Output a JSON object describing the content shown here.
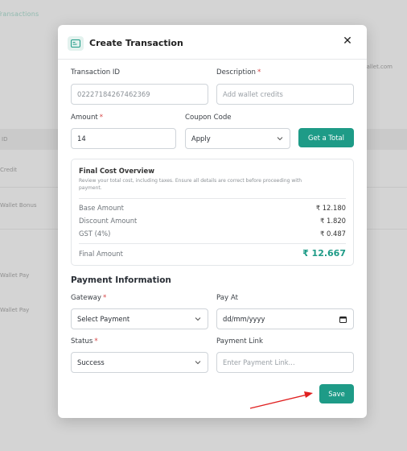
{
  "background": {
    "breadcrumb": "Transactions",
    "header_cell": "ID",
    "right_text": "Wallet.com",
    "rows": [
      "Credit",
      "Wallet Bonus",
      "Wallet Pay",
      "Wallet Pay"
    ]
  },
  "modal": {
    "title": "Create Transaction",
    "close_icon": "close-icon",
    "transaction_id": {
      "label": "Transaction ID",
      "value": "02227184267462369"
    },
    "description": {
      "label": "Description",
      "placeholder": "Add wallet credits"
    },
    "amount": {
      "label": "Amount",
      "value": "14"
    },
    "coupon_code": {
      "label": "Coupon Code",
      "selected": "Apply"
    },
    "get_total_label": "Get a Total",
    "cost_overview": {
      "title": "Final Cost Overview",
      "description": "Review your total cost, including taxes. Ensure all details are correct before proceeding with payment.",
      "rows": [
        {
          "label": "Base Amount",
          "value": "₹ 12.180"
        },
        {
          "label": "Discount Amount",
          "value": "₹ 1.820"
        },
        {
          "label": "GST (4%)",
          "value": "₹ 0.487"
        }
      ],
      "final": {
        "label": "Final Amount",
        "value": "₹ 12.667"
      }
    },
    "payment_section_title": "Payment Information",
    "gateway": {
      "label": "Gateway",
      "selected": "Select Payment"
    },
    "pay_at": {
      "label": "Pay At",
      "placeholder": "dd/mm/yyyy"
    },
    "status": {
      "label": "Status",
      "selected": "Success"
    },
    "payment_link": {
      "label": "Payment Link",
      "placeholder": "Enter Payment Link..."
    },
    "save_label": "Save"
  },
  "colors": {
    "accent": "#1e9b87",
    "required": "#d64545",
    "annotation_arrow": "#e02020"
  }
}
